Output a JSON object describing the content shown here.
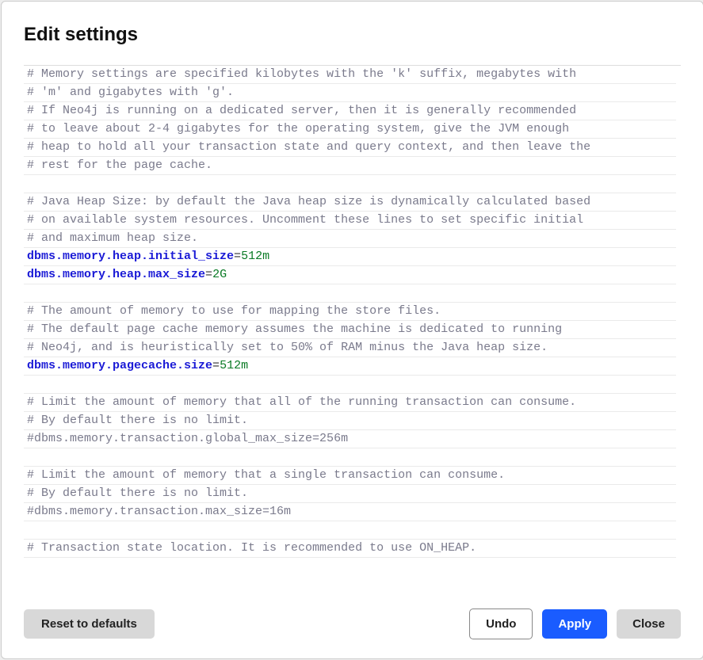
{
  "dialog": {
    "title": "Edit settings"
  },
  "editor": {
    "lines": [
      {
        "type": "comment",
        "text": "# Memory settings are specified kilobytes with the 'k' suffix, megabytes with"
      },
      {
        "type": "comment",
        "text": "# 'm' and gigabytes with 'g'."
      },
      {
        "type": "comment",
        "text": "# If Neo4j is running on a dedicated server, then it is generally recommended"
      },
      {
        "type": "comment",
        "text": "# to leave about 2-4 gigabytes for the operating system, give the JVM enough"
      },
      {
        "type": "comment",
        "text": "# heap to hold all your transaction state and query context, and then leave the"
      },
      {
        "type": "comment",
        "text": "# rest for the page cache."
      },
      {
        "type": "blank",
        "text": ""
      },
      {
        "type": "comment",
        "text": "# Java Heap Size: by default the Java heap size is dynamically calculated based"
      },
      {
        "type": "comment",
        "text": "# on available system resources. Uncomment these lines to set specific initial"
      },
      {
        "type": "comment",
        "text": "# and maximum heap size."
      },
      {
        "type": "setting",
        "key": "dbms.memory.heap.initial_size",
        "value": "512m"
      },
      {
        "type": "setting",
        "key": "dbms.memory.heap.max_size",
        "value": "2G"
      },
      {
        "type": "blank",
        "text": ""
      },
      {
        "type": "comment",
        "text": "# The amount of memory to use for mapping the store files."
      },
      {
        "type": "comment",
        "text": "# The default page cache memory assumes the machine is dedicated to running"
      },
      {
        "type": "comment",
        "text": "# Neo4j, and is heuristically set to 50% of RAM minus the Java heap size."
      },
      {
        "type": "setting",
        "key": "dbms.memory.pagecache.size",
        "value": "512m"
      },
      {
        "type": "blank",
        "text": ""
      },
      {
        "type": "comment",
        "text": "# Limit the amount of memory that all of the running transaction can consume."
      },
      {
        "type": "comment",
        "text": "# By default there is no limit."
      },
      {
        "type": "comment",
        "text": "#dbms.memory.transaction.global_max_size=256m"
      },
      {
        "type": "blank",
        "text": ""
      },
      {
        "type": "comment",
        "text": "# Limit the amount of memory that a single transaction can consume."
      },
      {
        "type": "comment",
        "text": "# By default there is no limit."
      },
      {
        "type": "comment",
        "text": "#dbms.memory.transaction.max_size=16m"
      },
      {
        "type": "blank",
        "text": ""
      },
      {
        "type": "comment",
        "text": "# Transaction state location. It is recommended to use ON_HEAP."
      }
    ]
  },
  "footer": {
    "reset_label": "Reset to defaults",
    "undo_label": "Undo",
    "apply_label": "Apply",
    "close_label": "Close"
  }
}
